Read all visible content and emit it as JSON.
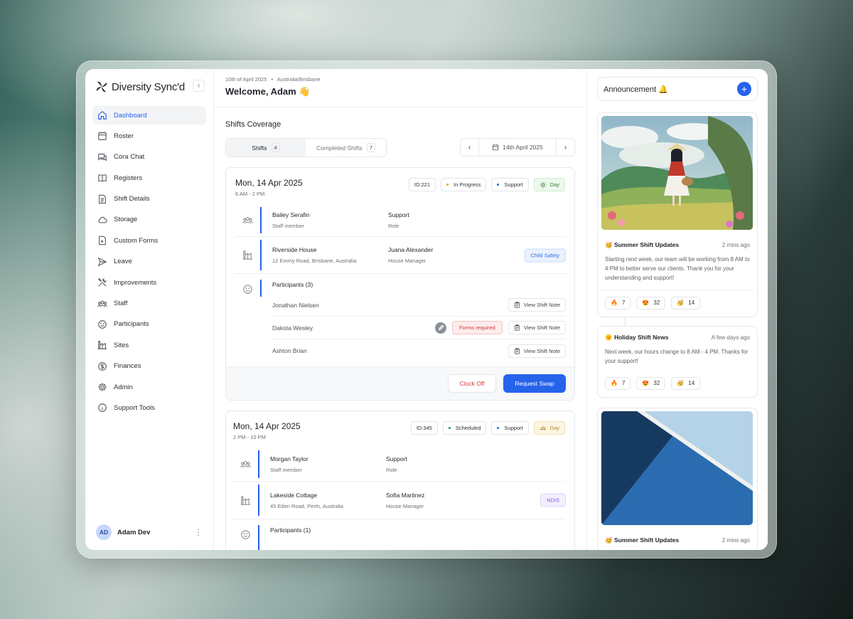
{
  "sidebar": {
    "brand": "Diversity Sync'd",
    "items": [
      {
        "label": "Dashboard",
        "icon": "home-icon",
        "active": true
      },
      {
        "label": "Roster",
        "icon": "calendar-icon"
      },
      {
        "label": "Cora Chat",
        "icon": "chat-icon"
      },
      {
        "label": "Registers",
        "icon": "book-icon"
      },
      {
        "label": "Shift Details",
        "icon": "document-icon"
      },
      {
        "label": "Storage",
        "icon": "cloud-icon"
      },
      {
        "label": "Custom Forms",
        "icon": "form-icon"
      },
      {
        "label": "Leave",
        "icon": "send-icon"
      },
      {
        "label": "Improvements",
        "icon": "tools-icon"
      },
      {
        "label": "Staff",
        "icon": "users-icon"
      },
      {
        "label": "Participants",
        "icon": "smile-icon"
      },
      {
        "label": "Sites",
        "icon": "building-icon"
      },
      {
        "label": "Finances",
        "icon": "dollar-icon"
      },
      {
        "label": "Admin",
        "icon": "gear-icon"
      },
      {
        "label": "Support Tools",
        "icon": "info-icon"
      }
    ],
    "user": {
      "initials": "AD",
      "name": "Adam Dev"
    }
  },
  "header": {
    "date": "10th of April 2025",
    "location": "Australia/Brisbane",
    "welcome": "Welcome, Adam 👋"
  },
  "coverage": {
    "title": "Shifts Coverage",
    "tabs": [
      {
        "label": "Shifts",
        "count": "4"
      },
      {
        "label": "Completed Shifts",
        "count": "7"
      }
    ],
    "date_label": "14th April 2025"
  },
  "shifts": [
    {
      "date": "Mon, 14 Apr 2025",
      "time": "6 AM - 2 PM",
      "id": "ID:221",
      "status": "In Progress",
      "status_color": "#f59e0b",
      "type": "Support",
      "type_color": "#2563eb",
      "period": "Day",
      "staff": {
        "name": "Bailey Serafin",
        "name_sub": "Staff member",
        "role": "Support",
        "role_sub": "Role"
      },
      "site": {
        "name": "Riverside House",
        "address": "12 Emmy Road, Brisbane, Australia",
        "manager": "Juana Alexander",
        "manager_sub": "House Manager",
        "tag": "Child Safety"
      },
      "participants_title": "Participants (3)",
      "participants": [
        {
          "name": "Jonathan Nielsen",
          "action": "View Shift Note"
        },
        {
          "name": "Dakota Wesley",
          "alert": "Forms required",
          "action": "View Shift Note"
        },
        {
          "name": "Ashton Brian",
          "action": "View Shift Note"
        }
      ],
      "actions": {
        "secondary": "Clock Off",
        "primary": "Request Swap"
      }
    },
    {
      "date": "Mon, 14 Apr 2025",
      "time": "2 PM - 10 PM",
      "id": "ID:345",
      "status": "Scheduled",
      "status_color": "#16a34a",
      "type": "Support",
      "type_color": "#2563eb",
      "period": "Day",
      "staff": {
        "name": "Morgan Taylor",
        "name_sub": "Staff member",
        "role": "Support",
        "role_sub": "Role"
      },
      "site": {
        "name": "Lakeside Cottage",
        "address": "45 Eden Road, Perth, Australia",
        "manager": "Sofia Martinez",
        "manager_sub": "House Manager",
        "tag": "NDIS"
      },
      "participants_title": "Participants (1)"
    }
  ],
  "announcements": {
    "title": "Announcement 🔔",
    "posts": [
      {
        "title": "🥳 Summer Shift Updates",
        "time": "2 mins ago",
        "body": "Starting next week, our team will be working from 8 AM to 4 PM to better serve our clients. Thank you for your understanding and support!",
        "reactions": [
          {
            "emoji": "🔥",
            "count": "7"
          },
          {
            "emoji": "😍",
            "count": "32"
          },
          {
            "emoji": "🥳",
            "count": "14"
          }
        ]
      },
      {
        "title": "🌞 Holiday Shift News",
        "time": "A few days ago",
        "body": "Next week, our hours change to 8 AM - 4 PM. Thanks for your support!",
        "reactions": [
          {
            "emoji": "🔥",
            "count": "7"
          },
          {
            "emoji": "😍",
            "count": "32"
          },
          {
            "emoji": "🥳",
            "count": "14"
          }
        ]
      },
      {
        "title": "🥳 Summer Shift Updates",
        "time": "2 mins ago"
      }
    ]
  }
}
